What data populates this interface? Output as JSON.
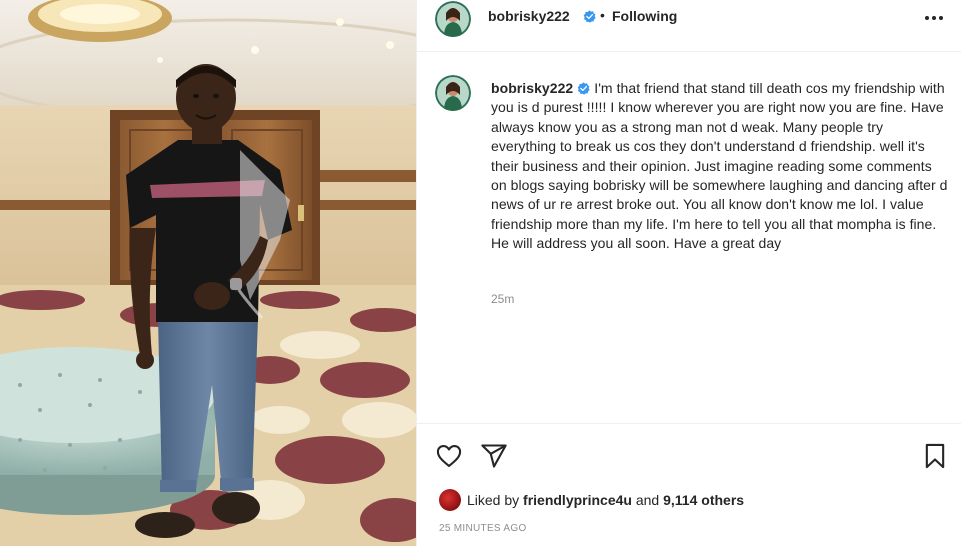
{
  "post": {
    "username": "bobrisky222",
    "follow_separator": "•",
    "follow_status": "Following",
    "caption": "I'm that friend that stand till death cos my friendship with you is d purest !!!!! I know wherever you are right now you are fine. Have always know you as a strong man not d weak. Many people try everything to break us cos they don't understand d friendship. well it's their business and their opinion. Just imagine reading some comments on blogs saying bobrisky will be somewhere laughing and dancing after d news of ur re arrest broke out. You all know don't know me lol. I value friendship more than my life. I'm here to tell you all that mompha is fine. He will address you all soon. Have a great day",
    "caption_age": "25m",
    "likes_prefix": "Liked by",
    "liked_by_user": "friendlyprince4u",
    "likes_and": "and",
    "others_count": "9,114 others",
    "posted_ago": "25 MINUTES AGO"
  },
  "icons": {
    "verified": "verified-badge-icon",
    "more": "more-options-icon",
    "like": "heart-icon",
    "share": "send-icon",
    "save": "bookmark-icon"
  },
  "colors": {
    "verified_blue": "#3897f0",
    "secondary_text": "#8e8e8e",
    "primary_text": "#262626",
    "divider": "#efefef"
  }
}
